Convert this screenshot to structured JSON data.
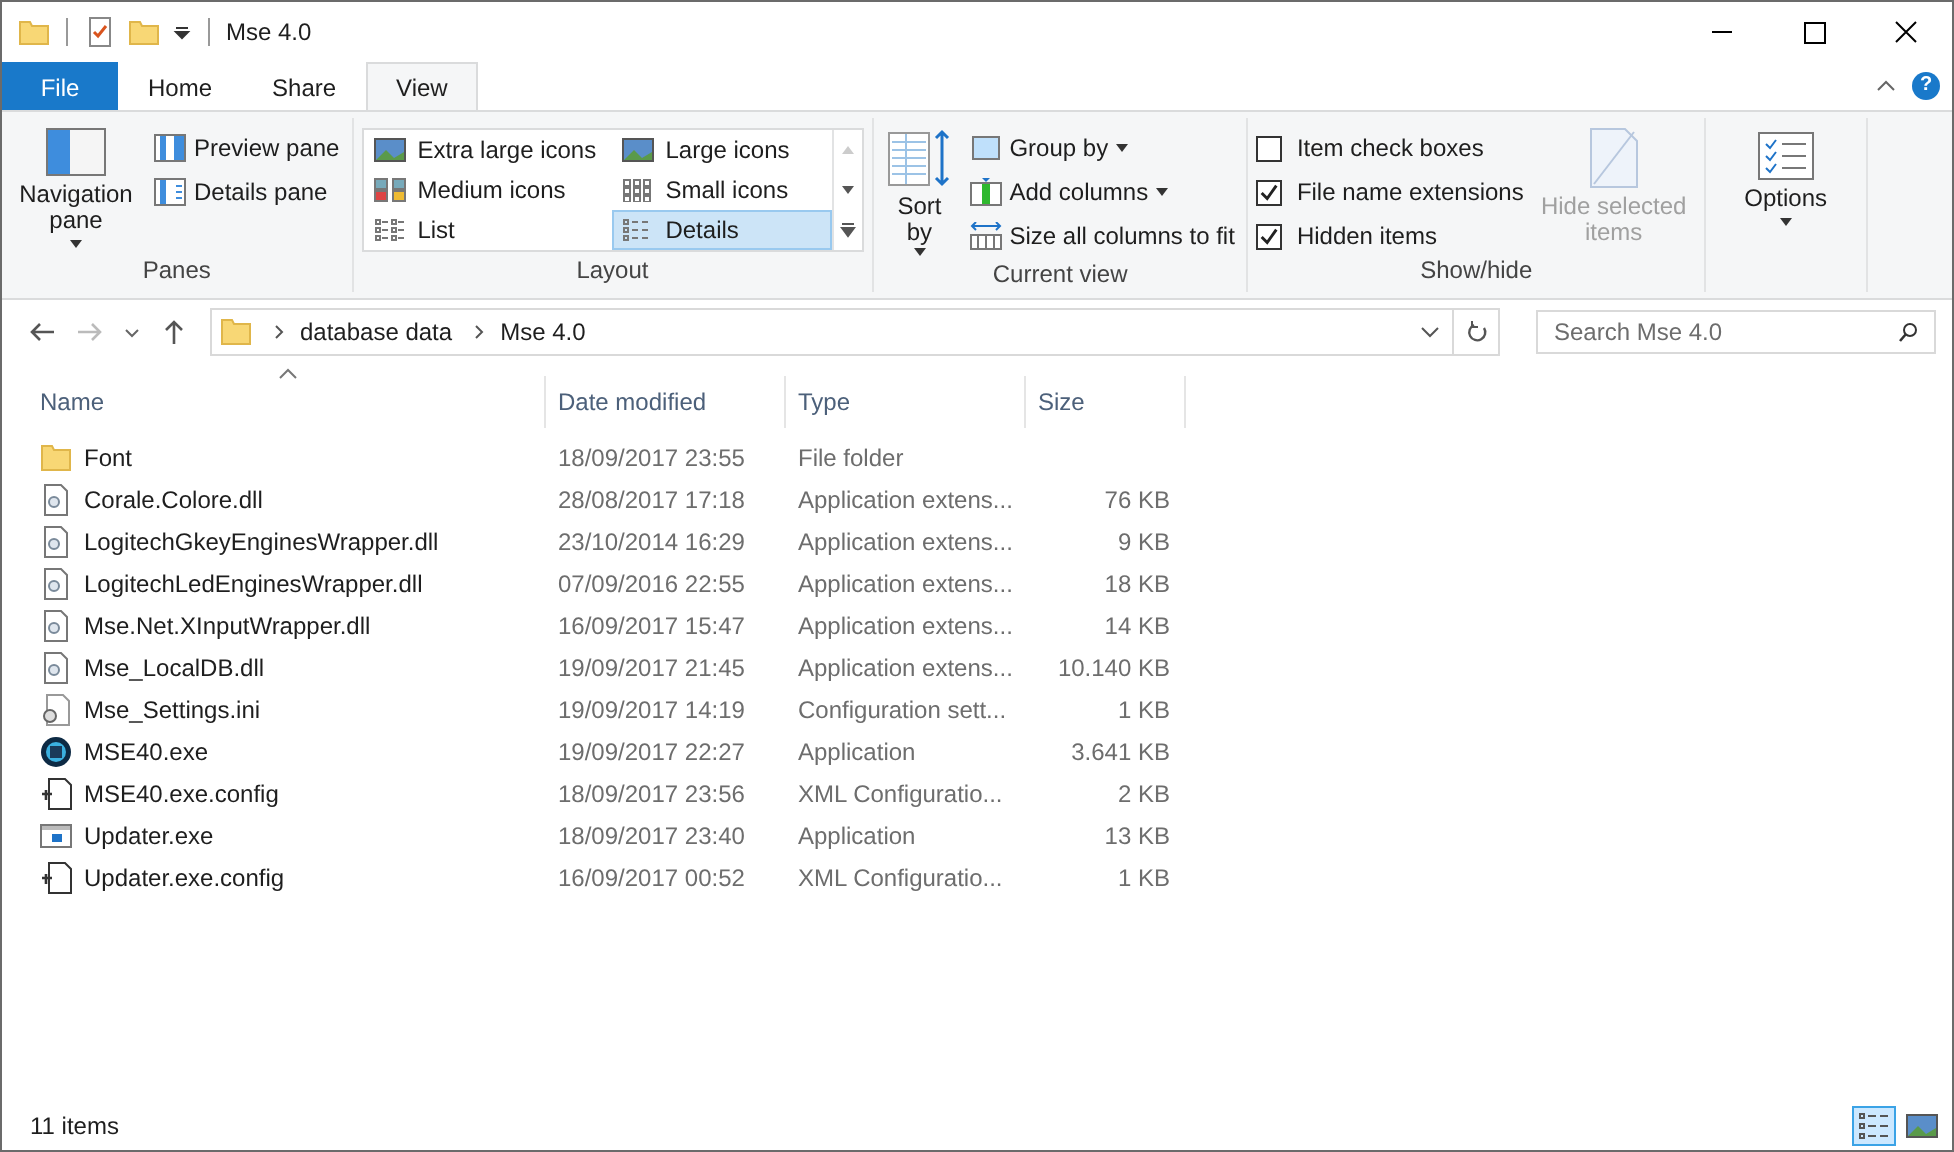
{
  "window": {
    "title": "Mse 4.0"
  },
  "tabs": [
    {
      "label": "File",
      "kind": "file",
      "selected": false
    },
    {
      "label": "Home",
      "kind": "tab",
      "selected": false
    },
    {
      "label": "Share",
      "kind": "tab",
      "selected": false
    },
    {
      "label": "View",
      "kind": "tab",
      "selected": true
    }
  ],
  "help": {
    "label": "?"
  },
  "panes": {
    "label": "Panes",
    "navigation_pane": "Navigation pane",
    "items": [
      "Preview pane",
      "Details pane"
    ]
  },
  "layout": {
    "label": "Layout",
    "options": [
      {
        "label": "Extra large icons",
        "selected": false
      },
      {
        "label": "Large icons",
        "selected": false
      },
      {
        "label": "Medium icons",
        "selected": false
      },
      {
        "label": "Small icons",
        "selected": false
      },
      {
        "label": "List",
        "selected": false
      },
      {
        "label": "Details",
        "selected": true
      }
    ]
  },
  "current_view": {
    "label": "Current view",
    "sort_by": "Sort by",
    "items": [
      "Group by",
      "Add columns",
      "Size all columns to fit"
    ]
  },
  "show_hide": {
    "label": "Show/hide",
    "checkboxes": [
      {
        "label": "Item check boxes",
        "checked": false
      },
      {
        "label": "File name extensions",
        "checked": true
      },
      {
        "label": "Hidden items",
        "checked": true
      }
    ],
    "hide_selected": {
      "label": "Hide selected items",
      "disabled": true
    }
  },
  "options": {
    "label": "Options"
  },
  "address": {
    "segments": [
      "database data",
      "Mse 4.0"
    ]
  },
  "search": {
    "placeholder": "Search Mse 4.0"
  },
  "table": {
    "columns": [
      "Name",
      "Date modified",
      "Type",
      "Size"
    ],
    "rows": [
      {
        "kind": "folder",
        "name": "Font",
        "date": "18/09/2017 23:55",
        "type": "File folder",
        "size": ""
      },
      {
        "kind": "dll",
        "name": "Corale.Colore.dll",
        "date": "28/08/2017 17:18",
        "type": "Application extens...",
        "size": "76 KB"
      },
      {
        "kind": "dll",
        "name": "LogitechGkeyEnginesWrapper.dll",
        "date": "23/10/2014 16:29",
        "type": "Application extens...",
        "size": "9 KB"
      },
      {
        "kind": "dll",
        "name": "LogitechLedEnginesWrapper.dll",
        "date": "07/09/2016 22:55",
        "type": "Application extens...",
        "size": "18 KB"
      },
      {
        "kind": "dll",
        "name": "Mse.Net.XInputWrapper.dll",
        "date": "16/09/2017 15:47",
        "type": "Application extens...",
        "size": "14 KB"
      },
      {
        "kind": "dll",
        "name": "Mse_LocalDB.dll",
        "date": "19/09/2017 21:45",
        "type": "Application extens...",
        "size": "10.140 KB"
      },
      {
        "kind": "ini",
        "name": "Mse_Settings.ini",
        "date": "19/09/2017 14:19",
        "type": "Configuration sett...",
        "size": "1 KB"
      },
      {
        "kind": "app",
        "name": "MSE40.exe",
        "date": "19/09/2017 22:27",
        "type": "Application",
        "size": "3.641 KB"
      },
      {
        "kind": "config",
        "name": "MSE40.exe.config",
        "date": "18/09/2017 23:56",
        "type": "XML Configuratio...",
        "size": "2 KB"
      },
      {
        "kind": "exe",
        "name": "Updater.exe",
        "date": "18/09/2017 23:40",
        "type": "Application",
        "size": "13 KB"
      },
      {
        "kind": "config",
        "name": "Updater.exe.config",
        "date": "16/09/2017 00:52",
        "type": "XML Configuratio...",
        "size": "1 KB"
      }
    ]
  },
  "status_bar": {
    "text": "11 items",
    "views": [
      {
        "kind": "details",
        "selected": true
      },
      {
        "kind": "large",
        "selected": false
      }
    ]
  }
}
